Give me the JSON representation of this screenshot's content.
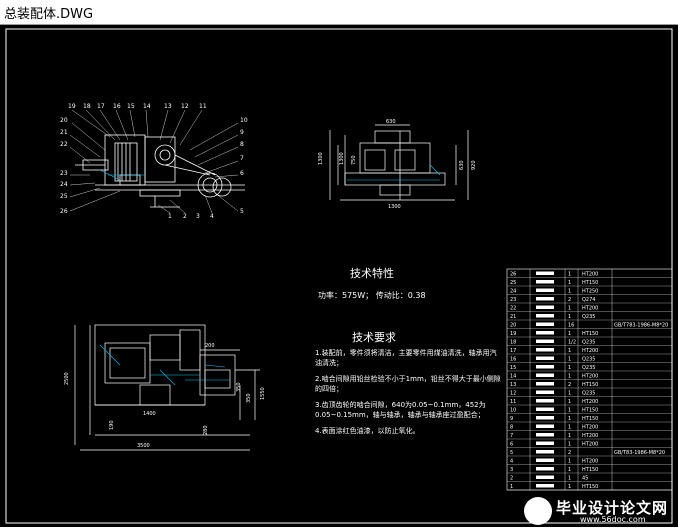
{
  "window": {
    "title": "总装配体.DWG"
  },
  "drawing": {
    "front_view": {
      "part_labels_top": [
        "19",
        "18",
        "17",
        "16",
        "15",
        "14",
        "13",
        "12",
        "11"
      ],
      "part_labels_left": [
        "20",
        "21",
        "22",
        "23",
        "24",
        "25",
        "26"
      ],
      "part_labels_right": [
        "10",
        "9",
        "8",
        "7",
        "6",
        "5"
      ],
      "part_labels_bottom": [
        "1",
        "2",
        "3",
        "4"
      ]
    },
    "side_view": {
      "dims": [
        "630",
        "1300",
        "1300",
        "750",
        "1300",
        "920",
        "630"
      ]
    },
    "plan_view": {
      "dims": [
        "2500",
        "1400",
        "350",
        "350",
        "200",
        "3500",
        "190",
        "280",
        "1550"
      ]
    },
    "tech_characteristics": {
      "heading": "技术特性",
      "line": "功率：575W；   传动比：0.38"
    },
    "tech_requirements": {
      "heading": "技术要求",
      "items": [
        "1.装配前，零件须将清洁，主要零件用煤油清洗，轴承用汽油清洗；",
        "2.啮合间隙用铅丝检验不小于1mm，铅丝不得大于最小侧隙的四倍；",
        "3.齿顶齿轮的啮合间隙，640为0.05~0.1mm，452为0.05~0.15mm，轴与轴承，轴承与轴承座过盈配合；",
        "4.表面涂红色油漆，以防止氧化。"
      ]
    },
    "bom_table": {
      "rows": [
        {
          "no": "26",
          "qty": "1",
          "mat": "HT200",
          "note": ""
        },
        {
          "no": "25",
          "qty": "1",
          "mat": "HT150",
          "note": ""
        },
        {
          "no": "24",
          "qty": "1",
          "mat": "HT250",
          "note": ""
        },
        {
          "no": "23",
          "qty": "2",
          "mat": "Q274",
          "note": ""
        },
        {
          "no": "22",
          "qty": "1",
          "mat": "HT200",
          "note": ""
        },
        {
          "no": "21",
          "qty": "1",
          "mat": "Q235",
          "note": ""
        },
        {
          "no": "20",
          "qty": "16",
          "mat": "",
          "note": "GB/T783-1986-M8*20"
        },
        {
          "no": "19",
          "qty": "1",
          "mat": "HT150",
          "note": ""
        },
        {
          "no": "18",
          "qty": "1/2",
          "mat": "Q235",
          "note": ""
        },
        {
          "no": "17",
          "qty": "1",
          "mat": "HT200",
          "note": ""
        },
        {
          "no": "16",
          "qty": "1",
          "mat": "Q235",
          "note": ""
        },
        {
          "no": "15",
          "qty": "1",
          "mat": "Q235",
          "note": ""
        },
        {
          "no": "14",
          "qty": "1",
          "mat": "HT200",
          "note": ""
        },
        {
          "no": "13",
          "qty": "2",
          "mat": "HT150",
          "note": ""
        },
        {
          "no": "12",
          "qty": "1",
          "mat": "Q235",
          "note": ""
        },
        {
          "no": "11",
          "qty": "1",
          "mat": "HT200",
          "note": ""
        },
        {
          "no": "10",
          "qty": "1",
          "mat": "HT150",
          "note": ""
        },
        {
          "no": "9",
          "qty": "1",
          "mat": "HT150",
          "note": ""
        },
        {
          "no": "8",
          "qty": "1",
          "mat": "HT200",
          "note": ""
        },
        {
          "no": "7",
          "qty": "1",
          "mat": "HT200",
          "note": ""
        },
        {
          "no": "6",
          "qty": "1",
          "mat": "HT200",
          "note": ""
        },
        {
          "no": "5",
          "qty": "2",
          "mat": "",
          "note": "GB/T83-1986-M8*20"
        },
        {
          "no": "4",
          "qty": "1",
          "mat": "HT200",
          "note": ""
        },
        {
          "no": "3",
          "qty": "1",
          "mat": "HT150",
          "note": ""
        },
        {
          "no": "2",
          "qty": "1",
          "mat": "45",
          "note": ""
        },
        {
          "no": "1",
          "qty": "1",
          "mat": "HT150",
          "note": ""
        }
      ]
    }
  },
  "watermark": {
    "brand": "毕业设计论文网",
    "url": "www.56doc.com"
  },
  "colors": {
    "background": "#000000",
    "lines": "#ffffff",
    "accent": "#00c8ff"
  }
}
